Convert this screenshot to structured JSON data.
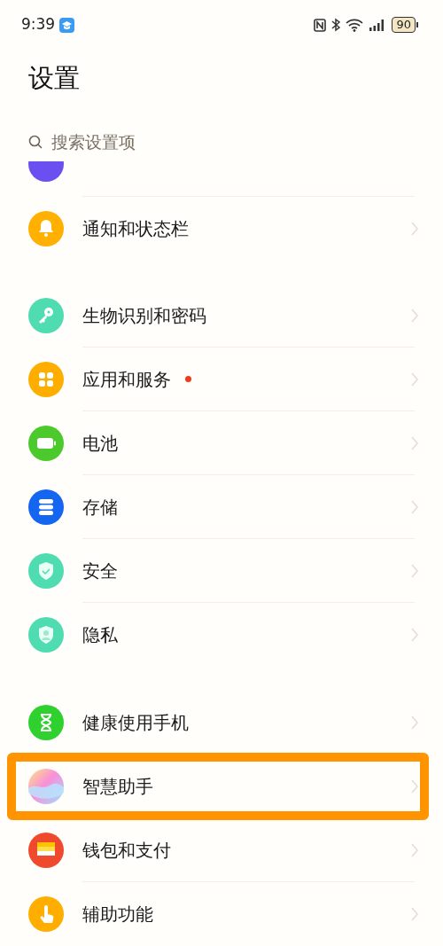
{
  "status_bar": {
    "time": "9:39",
    "battery": "90"
  },
  "title": "设置",
  "search": {
    "placeholder": "搜索设置项"
  },
  "groups": [
    {
      "items": [
        {
          "label": "通知和状态栏",
          "badge_dot": false,
          "highlighted": false
        }
      ]
    },
    {
      "items": [
        {
          "label": "生物识别和密码",
          "badge_dot": false,
          "highlighted": false
        },
        {
          "label": "应用和服务",
          "badge_dot": true,
          "highlighted": false
        },
        {
          "label": "电池",
          "badge_dot": false,
          "highlighted": false
        },
        {
          "label": "存储",
          "badge_dot": false,
          "highlighted": false
        },
        {
          "label": "安全",
          "badge_dot": false,
          "highlighted": false
        },
        {
          "label": "隐私",
          "badge_dot": false,
          "highlighted": false
        }
      ]
    },
    {
      "items": [
        {
          "label": "健康使用手机",
          "badge_dot": false,
          "highlighted": false
        },
        {
          "label": "智慧助手",
          "badge_dot": false,
          "highlighted": true
        },
        {
          "label": "钱包和支付",
          "badge_dot": false,
          "highlighted": false
        },
        {
          "label": "辅助功能",
          "badge_dot": false,
          "highlighted": false
        }
      ]
    }
  ]
}
